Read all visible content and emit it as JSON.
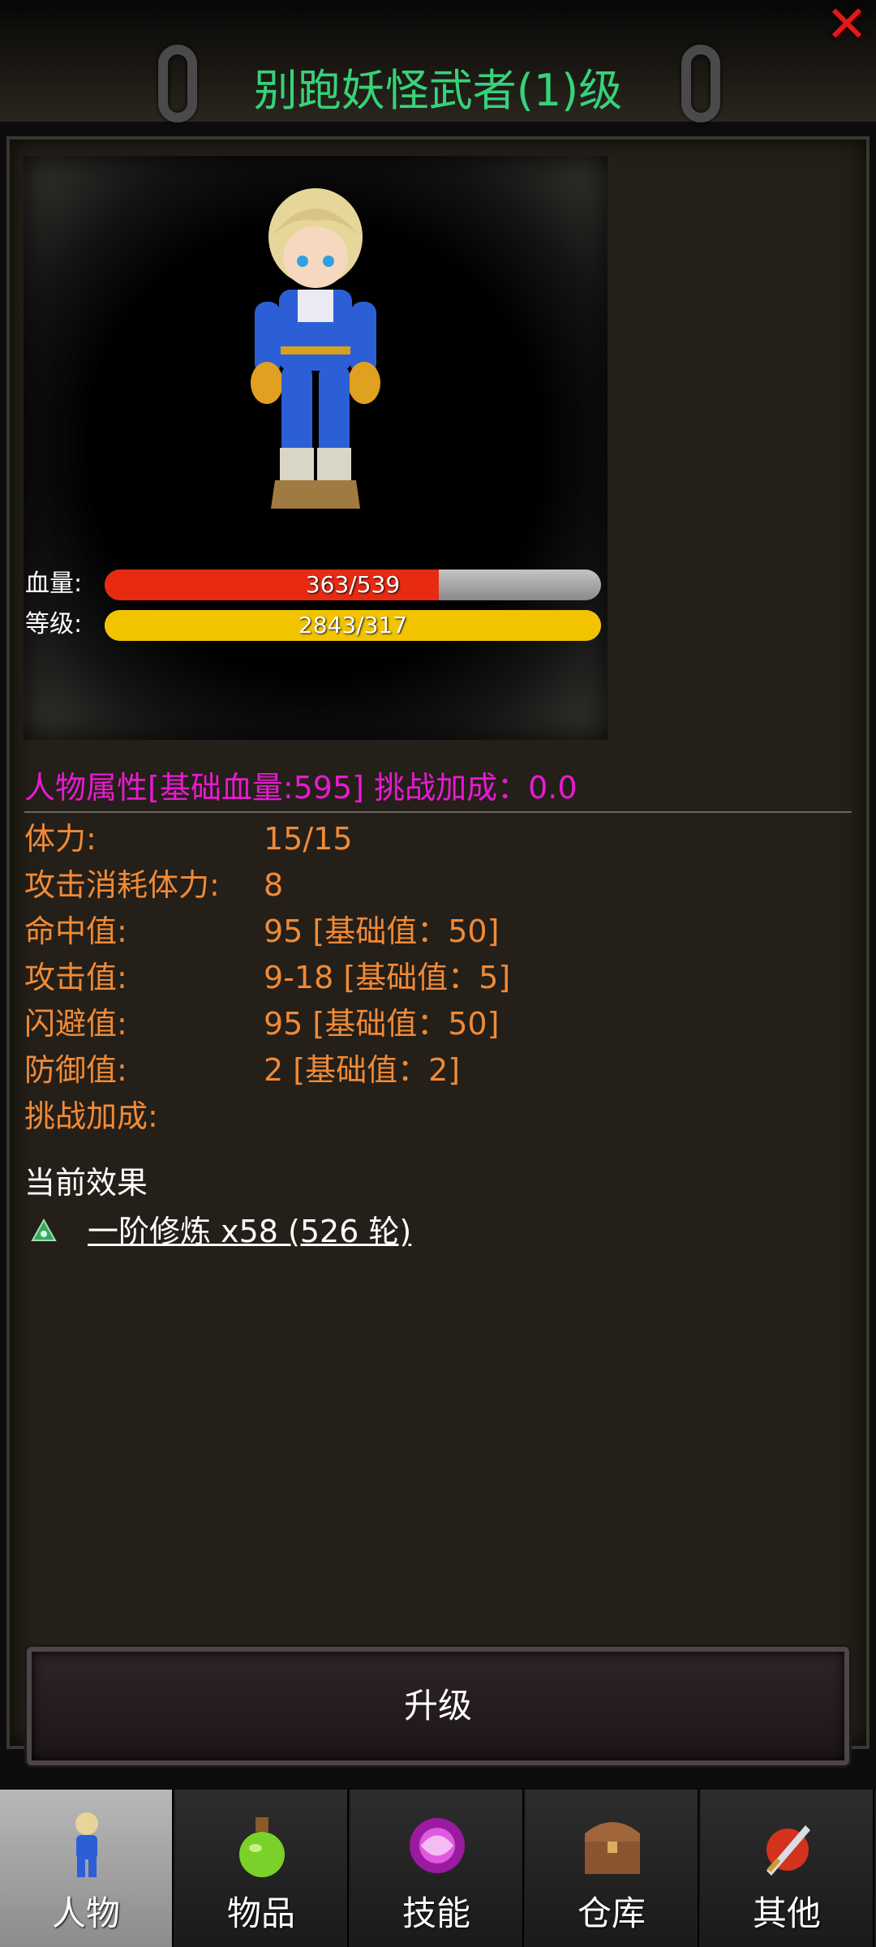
{
  "header": {
    "title": "别跑妖怪武者(1)级",
    "close_icon": "close-icon"
  },
  "portrait": {
    "hp_label": "血量:",
    "hp_text": "363/539",
    "hp_fraction": 0.673,
    "hp_color": "#e82a12",
    "level_label": "等级:",
    "level_text": "2843/317",
    "level_fraction": 1.0,
    "level_color": "#f2c400"
  },
  "attributes": {
    "header": "人物属性[基础血量:595] 挑战加成：0.0",
    "rows": [
      {
        "key": "体力:",
        "value": "15/15"
      },
      {
        "key": "攻击消耗体力:",
        "value": "8"
      },
      {
        "key": "命中值:",
        "value": "95 [基础值：50]"
      },
      {
        "key": "攻击值:",
        "value": "9-18 [基础值：5]"
      },
      {
        "key": "闪避值:",
        "value": "95 [基础值：50]"
      },
      {
        "key": "防御值:",
        "value": "2 [基础值：2]"
      },
      {
        "key": "挑战加成:",
        "value": ""
      }
    ]
  },
  "effects": {
    "title": "当前效果",
    "items": [
      {
        "icon": "triangle-gem-icon",
        "text": "一阶修炼 x58 (526 轮)"
      }
    ]
  },
  "upgrade_button": {
    "label": "升级"
  },
  "nav": {
    "tabs": [
      {
        "label": "人物",
        "icon": "character-icon",
        "active": true
      },
      {
        "label": "物品",
        "icon": "potion-icon",
        "active": false
      },
      {
        "label": "技能",
        "icon": "skill-orb-icon",
        "active": false
      },
      {
        "label": "仓库",
        "icon": "chest-icon",
        "active": false
      },
      {
        "label": "其他",
        "icon": "sword-icon",
        "active": false
      }
    ]
  }
}
